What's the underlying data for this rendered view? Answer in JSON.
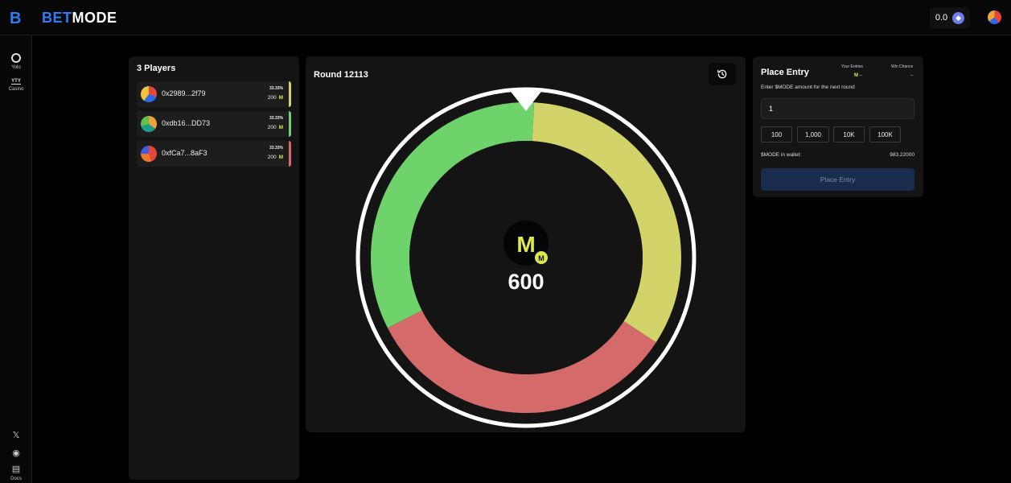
{
  "brand": {
    "logo_letter": "B",
    "name_part1": "BET",
    "name_part2": "MODE"
  },
  "header": {
    "balance": "0.0",
    "currency_icon": "eth-icon"
  },
  "nav": {
    "items": [
      {
        "label": "Yolo",
        "icon": "yolo-icon"
      },
      {
        "label": "Casino",
        "icon": "casino-icon",
        "glyph": "YTY"
      }
    ],
    "social": [
      {
        "icon": "x-icon",
        "glyph": "𝕏"
      },
      {
        "icon": "discord-icon",
        "glyph": "◉"
      },
      {
        "icon": "docs-icon",
        "glyph": "▤",
        "label": "Docs"
      }
    ]
  },
  "players": {
    "title": "3 Players",
    "list": [
      {
        "address": "0x2989...2f79",
        "percent": "33.33%",
        "amount": "200",
        "currency": "M",
        "color": "#d2d46a"
      },
      {
        "address": "0xdb16...DD73",
        "percent": "33.33%",
        "amount": "200",
        "currency": "M",
        "color": "#6ed36a"
      },
      {
        "address": "0xfCa7...8aF3",
        "percent": "33.33%",
        "amount": "200",
        "currency": "M",
        "color": "#d46a6a"
      }
    ]
  },
  "round": {
    "title": "Round 12113",
    "pot": "600",
    "token_symbol": "M",
    "token_badge": "M",
    "history_icon": "history-icon"
  },
  "chart_data": {
    "type": "pie",
    "title": "",
    "categories": [
      "0x2989...2f79",
      "0xfCa7...8aF3",
      "0xdb16...DD73"
    ],
    "values": [
      200,
      200,
      200
    ],
    "colors": [
      "#d2d46a",
      "#d46a6a",
      "#6ed36a"
    ]
  },
  "entry": {
    "title": "Place Entry",
    "your_entries_label": "Your Entries",
    "your_entries_currency": "M",
    "your_entries_value": "–",
    "win_chance_label": "Win Chance",
    "win_chance_value": "–",
    "hint": "Enter $MODE amount for the next round",
    "input_value": "1",
    "quick_amounts": [
      "100",
      "1,000",
      "10K",
      "100K"
    ],
    "wallet_label": "$MODE in wallet:",
    "wallet_value": "983.22000",
    "submit_label": "Place Entry"
  }
}
